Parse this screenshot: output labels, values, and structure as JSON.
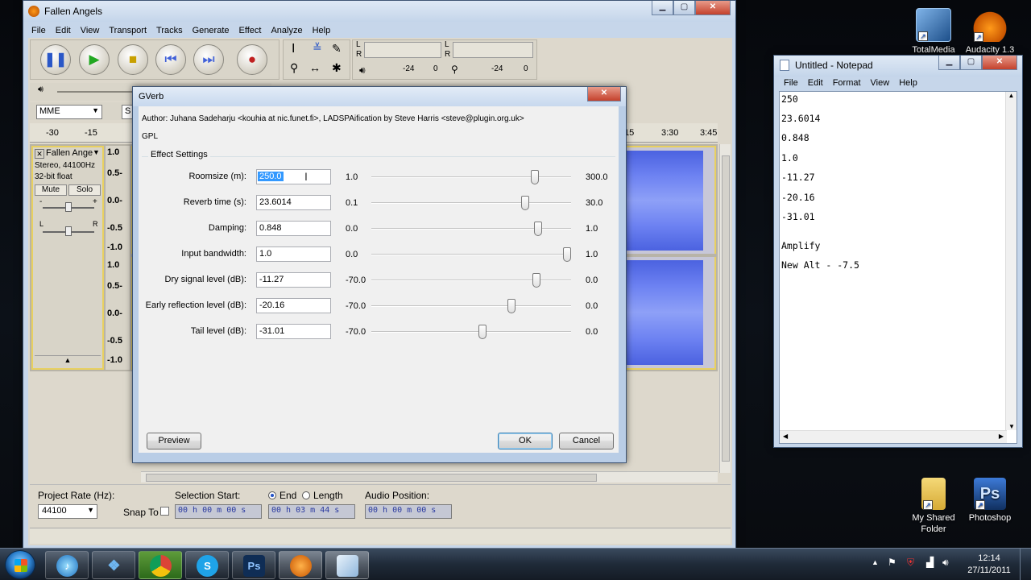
{
  "desktop": {
    "icons": [
      {
        "label": "TotalMedia",
        "name": "totalmedia-icon"
      },
      {
        "label": "Audacity 1.3",
        "name": "audacity-desktop-icon"
      },
      {
        "label": "My Shared Folder",
        "name": "shared-folder-icon"
      },
      {
        "label": "Photoshop",
        "name": "photoshop-desktop-icon"
      }
    ]
  },
  "audacity": {
    "title": "Fallen Angels",
    "menu": [
      "File",
      "Edit",
      "View",
      "Transport",
      "Tracks",
      "Generate",
      "Effect",
      "Analyze",
      "Help"
    ],
    "meter": {
      "l": "L",
      "r": "R",
      "db1": "-24",
      "zero1": "0",
      "db2": "-24",
      "zero2": "0"
    },
    "device": "MME",
    "device_partial": "S",
    "timeline": [
      "-30",
      "-15",
      "15",
      "3:30",
      "3:45"
    ],
    "track": {
      "name": "Fallen Ange",
      "info1": "Stereo, 44100Hz",
      "info2": "32-bit float",
      "mute": "Mute",
      "solo": "Solo",
      "minus": "-",
      "plus": "+",
      "left": "L",
      "right": "R",
      "scale": [
        "1.0",
        "0.5-",
        "0.0-",
        "-0.5",
        "-1.0",
        "1.0",
        "0.5-",
        "0.0-",
        "-0.5",
        "-1.0"
      ]
    },
    "bottom": {
      "rate_label": "Project Rate (Hz):",
      "rate_value": "44100",
      "snap_label": "Snap To",
      "sel_start_label": "Selection Start:",
      "end_label": "End",
      "length_label": "Length",
      "audio_pos_label": "Audio Position:",
      "sel_start_value": "00 h 00 m 00 s",
      "end_value": "00 h 03 m 44 s",
      "audio_pos_value": "00 h 00 m 00 s"
    }
  },
  "gverb": {
    "title": "GVerb",
    "author": "Author: Juhana Sadeharju <kouhia at nic.funet.fi>, LADSPAification by Steve Harris <steve@plugin.org.uk>",
    "license": "GPL",
    "group": "Effect Settings",
    "params": [
      {
        "label": "Roomsize (m):",
        "value": "250.0",
        "min": "1.0",
        "max": "300.0",
        "pos": 0.83
      },
      {
        "label": "Reverb time (s):",
        "value": "23.6014",
        "min": "0.1",
        "max": "30.0",
        "pos": 0.78
      },
      {
        "label": "Damping:",
        "value": "0.848",
        "min": "0.0",
        "max": "1.0",
        "pos": 0.85
      },
      {
        "label": "Input bandwidth:",
        "value": "1.0",
        "min": "0.0",
        "max": "1.0",
        "pos": 1.0
      },
      {
        "label": "Dry signal level (dB):",
        "value": "-11.27",
        "min": "-70.0",
        "max": "0.0",
        "pos": 0.84
      },
      {
        "label": "Early reflection level (dB):",
        "value": "-20.16",
        "min": "-70.0",
        "max": "0.0",
        "pos": 0.71
      },
      {
        "label": "Tail level (dB):",
        "value": "-31.01",
        "min": "-70.0",
        "max": "0.0",
        "pos": 0.56
      }
    ],
    "preview": "Preview",
    "ok": "OK",
    "cancel": "Cancel"
  },
  "notepad": {
    "title": "Untitled - Notepad",
    "menu": [
      "File",
      "Edit",
      "Format",
      "View",
      "Help"
    ],
    "lines": [
      "250",
      "23.6014",
      "0.848",
      "1.0",
      "-11.27",
      "-20.16",
      "-31.01",
      "",
      "Amplify",
      "New Alt - -7.5"
    ]
  },
  "taskbar": {
    "apps": [
      "itunes",
      "dropbox",
      "chrome",
      "skype",
      "photoshop",
      "audacity",
      "notepad"
    ],
    "ps_glyph": "Ps",
    "time": "12:14",
    "date": "27/11/2011"
  },
  "colors": {
    "waveform": "#4b62e0",
    "dialog_bg": "#f0f0f0",
    "selection": "#3399ff"
  }
}
